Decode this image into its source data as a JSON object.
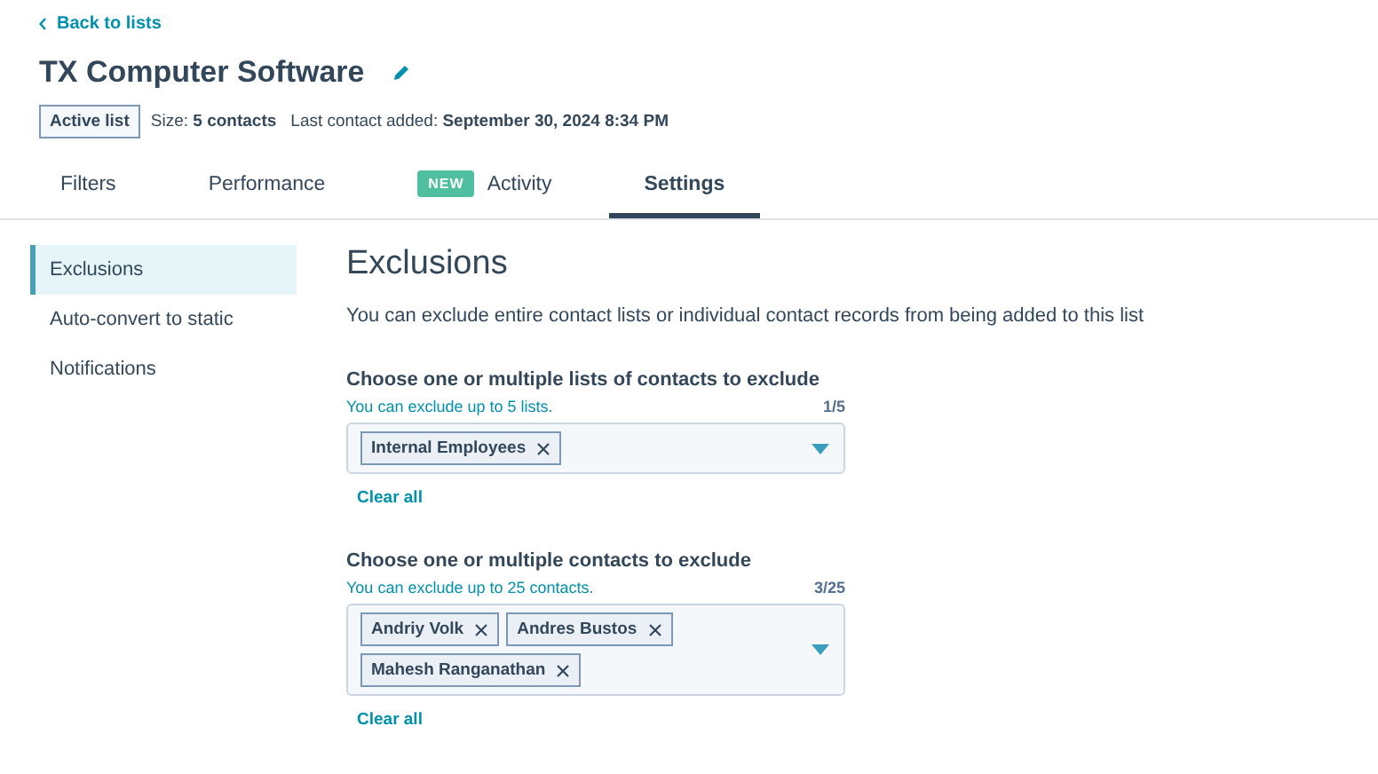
{
  "back_link": "Back to lists",
  "title": "TX Computer Software",
  "status_badge": "Active list",
  "meta": [
    {
      "label": "Size:",
      "value": "5 contacts"
    },
    {
      "label": "Last contact added:",
      "value": "September 30, 2024 8:34 PM"
    }
  ],
  "tabs": [
    {
      "label": "Filters",
      "selected": false
    },
    {
      "label": "Performance",
      "selected": false
    },
    {
      "label": "Activity",
      "badge": "NEW",
      "selected": false
    },
    {
      "label": "Settings",
      "selected": true
    }
  ],
  "sidebar": {
    "items": [
      {
        "label": "Exclusions",
        "selected": true
      },
      {
        "label": "Auto-convert to static",
        "selected": false
      },
      {
        "label": "Notifications",
        "selected": false
      }
    ]
  },
  "content": {
    "heading": "Exclusions",
    "description": "You can exclude entire contact lists or individual contact records from being added to this list",
    "sections": [
      {
        "label": "Choose one or multiple lists of contacts to exclude",
        "hint": "You can exclude up to 5 lists.",
        "count": "1/5",
        "tags": [
          "Internal Employees"
        ],
        "clear": "Clear all"
      },
      {
        "label": "Choose one or multiple contacts to exclude",
        "hint": "You can exclude up to 25 contacts.",
        "count": "3/25",
        "tags": [
          "Andriy Volk",
          "Andres Bustos",
          "Mahesh Ranganathan"
        ],
        "clear": "Clear all"
      }
    ]
  }
}
